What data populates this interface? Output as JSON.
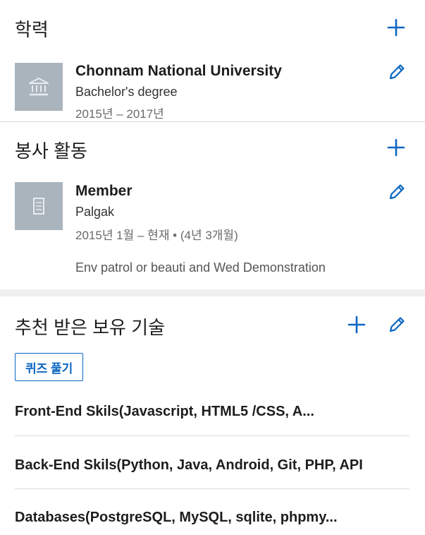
{
  "education": {
    "title": "학력",
    "entries": [
      {
        "school": "Chonnam National University",
        "degree": "Bachelor's degree",
        "dates": "2015년 – 2017년"
      }
    ]
  },
  "volunteer": {
    "title": "봉사 활동",
    "entries": [
      {
        "role": "Member",
        "org": "Palgak",
        "dates": "2015년 1월 – 현재 • (4년 3개월)",
        "description": "Env patrol or beauti and Wed Demonstration"
      }
    ]
  },
  "skills": {
    "title": "추천 받은 보유 기술",
    "quiz_label": "퀴즈 풀기",
    "items": [
      "Front-End Skils(Javascript, HTML5 /CSS, A...",
      "Back-End Skils(Python, Java, Android, Git, PHP, API",
      "Databases(PostgreSQL, MySQL, sqlite, phpmy..."
    ]
  },
  "colors": {
    "accent": "#0a66c2",
    "logo_bg": "#aab4bd",
    "divider": "#d6d6d6",
    "section_gap": "#f0f0f0"
  },
  "icons": {
    "add": "plus-icon",
    "edit": "pencil-icon",
    "school_logo": "institution-icon",
    "org_logo": "building-icon"
  }
}
